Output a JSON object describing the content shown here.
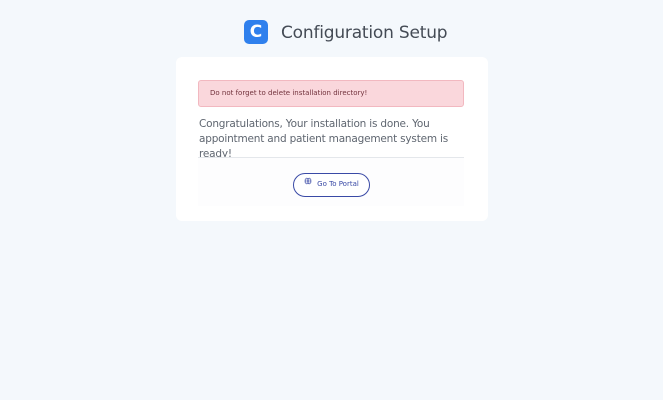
{
  "header": {
    "logo_letter": "C",
    "title": "Configuration Setup"
  },
  "alert": {
    "text": "Do not forget to delete installation directory!"
  },
  "message": {
    "text": "Congratulations, Your installation is done. You appointment and patient management system is ready!"
  },
  "portal_button": {
    "label": "Go To Portal",
    "icon": "globe-icon"
  },
  "colors": {
    "brand": "#2f80ed",
    "button": "#3a4aa6",
    "alert_bg": "#fad7dc",
    "page_bg": "#f4f8fc"
  }
}
